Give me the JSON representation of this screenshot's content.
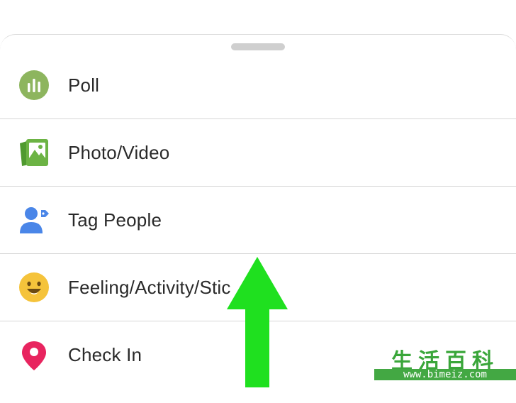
{
  "sheet": {
    "items": [
      {
        "label": "Poll",
        "icon": "poll-icon",
        "color": "#8db55e"
      },
      {
        "label": "Photo/Video",
        "icon": "photo-video-icon",
        "color": "#6cb344"
      },
      {
        "label": "Tag People",
        "icon": "tag-people-icon",
        "color": "#4a86e8"
      },
      {
        "label": "Feeling/Activity/Stic",
        "icon": "feeling-icon",
        "color": "#f5c33b"
      },
      {
        "label": "Check In",
        "icon": "location-pin-icon",
        "color": "#e8245f"
      }
    ]
  },
  "overlay": {
    "arrow_color": "#1fe01f",
    "watermark_text": "生活百科",
    "watermark_url": "www.bimeiz.com"
  }
}
